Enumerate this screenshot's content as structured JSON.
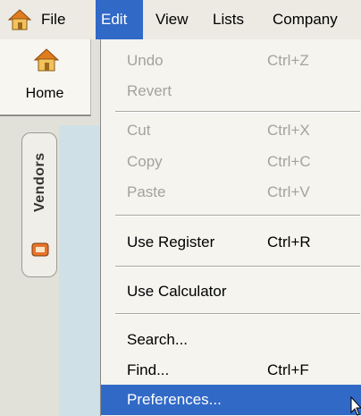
{
  "menubar": {
    "app_icon": "home-icon",
    "items": [
      "File",
      "Edit",
      "View",
      "Lists",
      "Company"
    ],
    "active_item": "Edit"
  },
  "side_panel": {
    "home_tab": {
      "label": "Home",
      "icon": "home-icon"
    },
    "vendors_tab": {
      "label": "Vendors",
      "icon": "vendors-icon"
    }
  },
  "edit_menu": {
    "undo": {
      "label": "Undo",
      "shortcut": "Ctrl+Z",
      "enabled": false
    },
    "revert": {
      "label": "Revert",
      "enabled": false
    },
    "cut": {
      "label": "Cut",
      "shortcut": "Ctrl+X",
      "enabled": false
    },
    "copy": {
      "label": "Copy",
      "shortcut": "Ctrl+C",
      "enabled": false
    },
    "paste": {
      "label": "Paste",
      "shortcut": "Ctrl+V",
      "enabled": false
    },
    "use_register": {
      "label": "Use Register",
      "shortcut": "Ctrl+R",
      "enabled": true
    },
    "use_calculator": {
      "label": "Use Calculator",
      "enabled": true
    },
    "search": {
      "label": "Search...",
      "enabled": true
    },
    "find": {
      "label": "Find...",
      "shortcut": "Ctrl+F",
      "enabled": true
    },
    "preferences": {
      "label": "Preferences...",
      "enabled": true,
      "highlighted": true
    }
  },
  "colors": {
    "highlight": "#3169c6",
    "menu_background": "#f5f4ef",
    "menubar_background": "#eceae2",
    "disabled_text": "#a3a39b",
    "rail_background": "#cfe1e7"
  }
}
